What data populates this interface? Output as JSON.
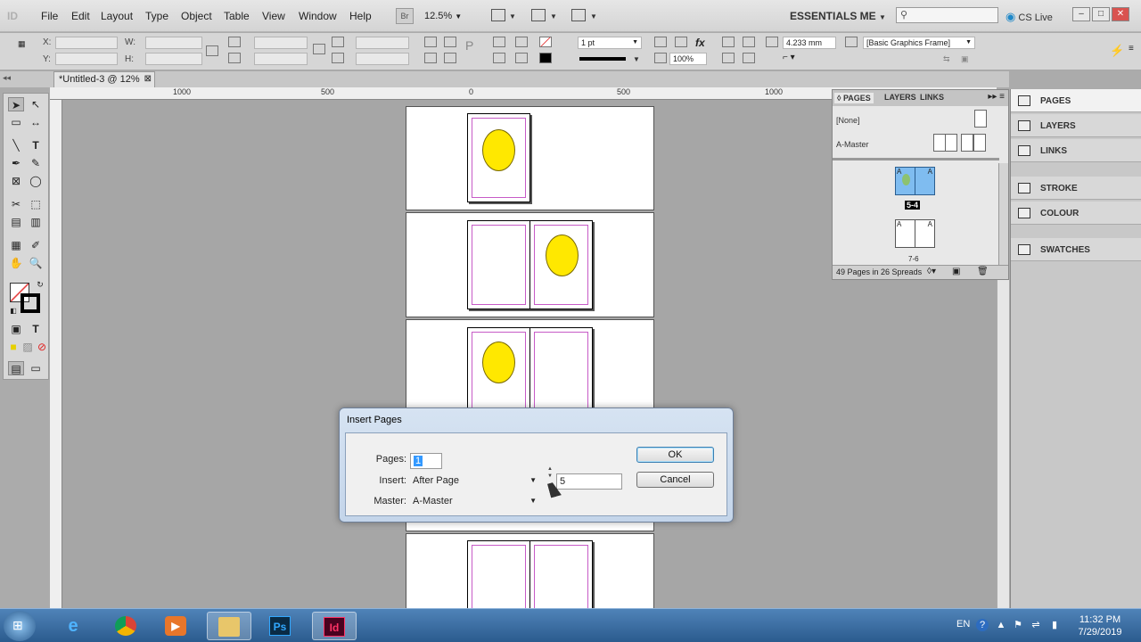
{
  "app": {
    "logo": "ID"
  },
  "menu": [
    "File",
    "Edit",
    "Layout",
    "Type",
    "Object",
    "Table",
    "View",
    "Window",
    "Help"
  ],
  "toolbar": {
    "bridge_label": "Br",
    "zoom": "12.5%",
    "workspace": "ESSENTIALS ME",
    "cs_live": "CS Live"
  },
  "control": {
    "x_label": "X:",
    "y_label": "Y:",
    "w_label": "W:",
    "h_label": "H:",
    "stroke_weight": "1 pt",
    "size": "4.233 mm",
    "scale": "100%",
    "frame_style": "[Basic Graphics Frame]"
  },
  "document": {
    "tab_title": "*Untitled-3 @ 12%"
  },
  "ruler": {
    "labels": [
      "1000",
      "500",
      "0",
      "500",
      "1000"
    ]
  },
  "pages_panel": {
    "tabs": [
      "PAGES",
      "LAYERS",
      "LINKS"
    ],
    "masters": [
      "[None]",
      "A-Master"
    ],
    "selected_spread_label": "5-4",
    "next_spread_label": "7-6",
    "master_prefix": "A",
    "count": "49 Pages in 26 Spreads"
  },
  "dock": [
    "PAGES",
    "LAYERS",
    "LINKS",
    "STROKE",
    "COLOUR",
    "SWATCHES"
  ],
  "dialog": {
    "title": "Insert Pages",
    "pages_label": "Pages:",
    "pages_value": "1",
    "insert_label": "Insert:",
    "insert_value": "After Page",
    "page_number": "5",
    "master_label": "Master:",
    "master_value": "A-Master",
    "ok": "OK",
    "cancel": "Cancel"
  },
  "taskbar": {
    "lang": "EN",
    "time": "11:32 PM",
    "date": "7/29/2019",
    "apps": [
      "IE",
      "Chrome",
      "Media",
      "Explorer",
      "Ps",
      "Id"
    ]
  },
  "colors": {
    "ellipse": "#ffe800",
    "margin": "#c75bc7",
    "selection": "#7fbcf0",
    "dialog_frame": "#c4d5ea"
  }
}
